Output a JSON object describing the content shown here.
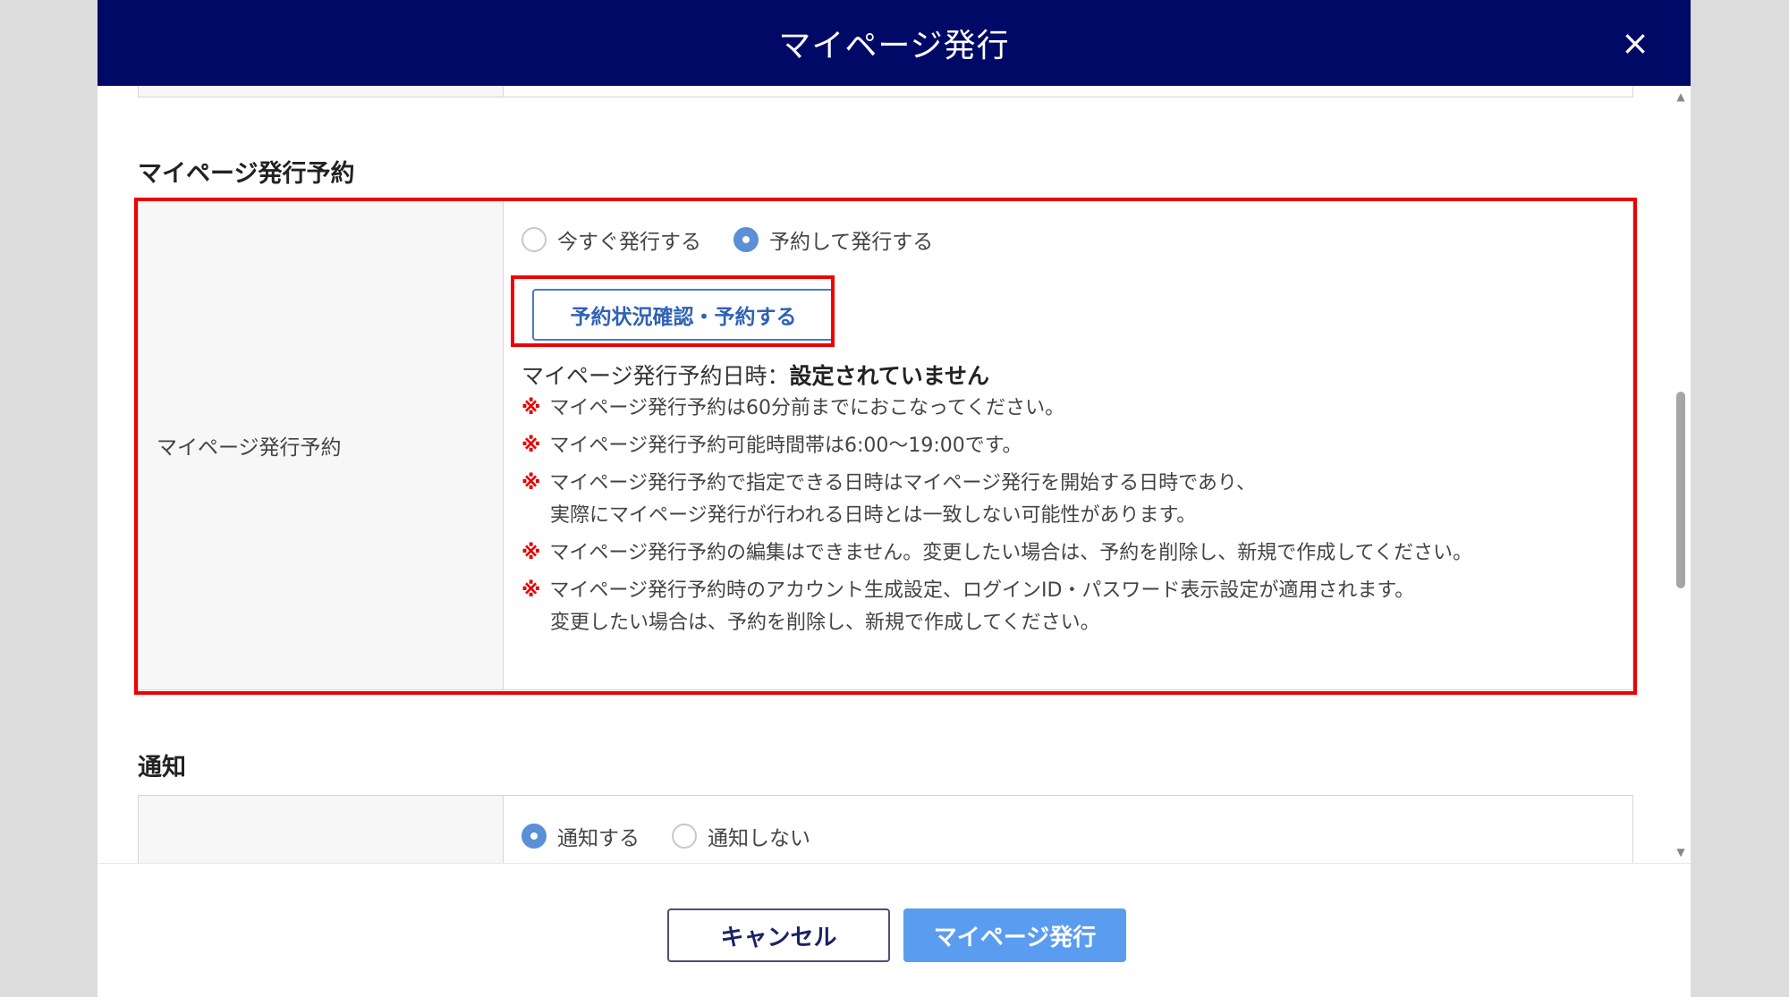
{
  "modal": {
    "title": "マイページ発行",
    "close_icon": "close-icon",
    "close_glyph": "×"
  },
  "reservation_section": {
    "title": "マイページ発行予約",
    "row_label": "マイページ発行予約",
    "radio_options": [
      {
        "label": "今すぐ発行する",
        "checked": false
      },
      {
        "label": "予約して発行する",
        "checked": true
      }
    ],
    "button_label": "予約状況確認・予約する",
    "date_label": "マイページ発行予約日時：",
    "date_value": "設定されていません",
    "note_mark": "※",
    "notes": [
      {
        "lines": [
          "マイページ発行予約は60分前までにおこなってください。"
        ]
      },
      {
        "lines": [
          "マイページ発行予約可能時間帯は6:00～19:00です。"
        ]
      },
      {
        "lines": [
          "マイページ発行予約で指定できる日時はマイページ発行を開始する日時であり、",
          "実際にマイページ発行が行われる日時とは一致しない可能性があります。"
        ]
      },
      {
        "lines": [
          "マイページ発行予約の編集はできません。変更したい場合は、予約を削除し、新規で作成してください。"
        ]
      },
      {
        "lines": [
          "マイページ発行予約時のアカウント生成設定、ログインID・パスワード表示設定が適用されます。",
          "変更したい場合は、予約を削除し、新規で作成してください。"
        ]
      }
    ]
  },
  "notification_section": {
    "title": "通知",
    "radio_options": [
      {
        "label": "通知する",
        "checked": true
      },
      {
        "label": "通知しない",
        "checked": false
      }
    ]
  },
  "footer": {
    "cancel_label": "キャンセル",
    "issue_label": "マイページ発行"
  },
  "colors": {
    "header_bg": "#000a66",
    "highlight": "#ee0000",
    "primary_button": "#5a9df0",
    "radio_checked": "#5b8fd6"
  }
}
